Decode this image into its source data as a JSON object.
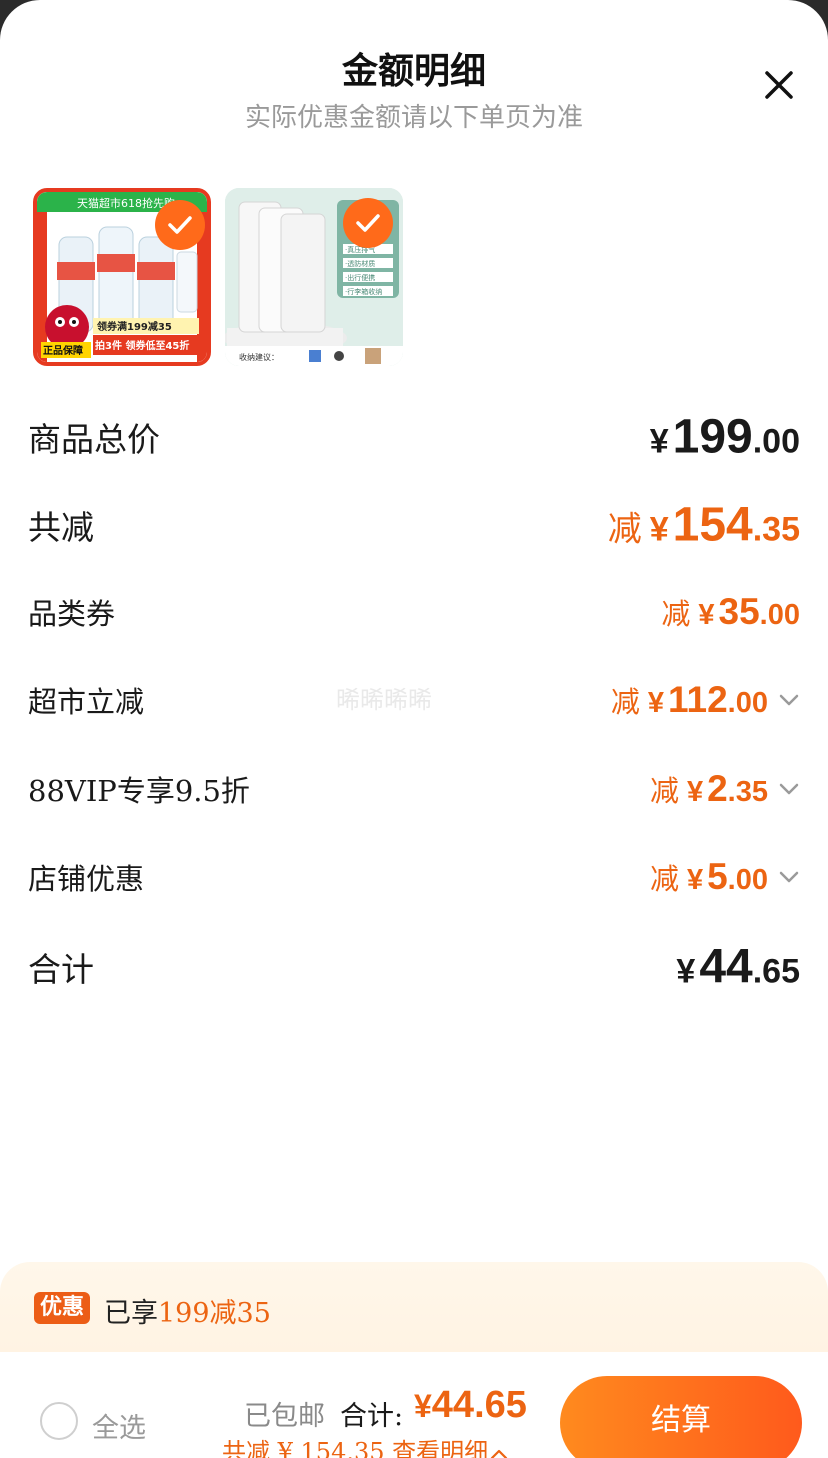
{
  "header": {
    "title": "金额明细",
    "subtitle": "实际优惠金额请以下单页为准"
  },
  "products": [
    {
      "banner": "天猫超市618抢先购",
      "promo_line1": "领券满199减35",
      "promo_line2": "拍3件 领券低至45折",
      "badge": "正品保障"
    },
    {
      "features": [
        "·真压排气",
        "·透防材质",
        "·出行便携",
        "·行李箱收纳"
      ],
      "caption": "收纳建议："
    }
  ],
  "rows": {
    "goods_total": {
      "label": "商品总价",
      "yen": "¥",
      "int": "199",
      "dec": ".00"
    },
    "total_saving": {
      "label": "共减",
      "prefix": "减",
      "yen": "¥",
      "int": "154",
      "dec": ".35"
    },
    "category_coupon": {
      "label": "品类券",
      "prefix": "减",
      "yen": "¥",
      "int": "35",
      "dec": ".00"
    },
    "market_discount": {
      "label": "超市立减",
      "prefix": "减",
      "yen": "¥",
      "int": "112",
      "dec": ".00"
    },
    "vip_discount": {
      "label": "88VIP专享9.5折",
      "prefix": "减",
      "yen": "¥",
      "int": "2",
      "dec": ".35"
    },
    "store_discount": {
      "label": "店铺优惠",
      "prefix": "减",
      "yen": "¥",
      "int": "5",
      "dec": ".00"
    },
    "grand_total": {
      "label": "合计",
      "yen": "¥",
      "int": "44",
      "dec": ".65"
    }
  },
  "watermark": "晞晞晞晞",
  "promo": {
    "tag": "优惠",
    "text": "已享",
    "highlight": "199减35"
  },
  "footer": {
    "select_all": "全选",
    "shipping": "已包邮",
    "total_label": "合计:",
    "total_yen": "¥",
    "total_value": "44.65",
    "saving_text": "共减 ¥ 154.35  查看明细",
    "checkout": "结算"
  },
  "colors": {
    "accent": "#ec6412",
    "checkout_start": "#ff8a1e",
    "checkout_end": "#ff5a1c"
  }
}
